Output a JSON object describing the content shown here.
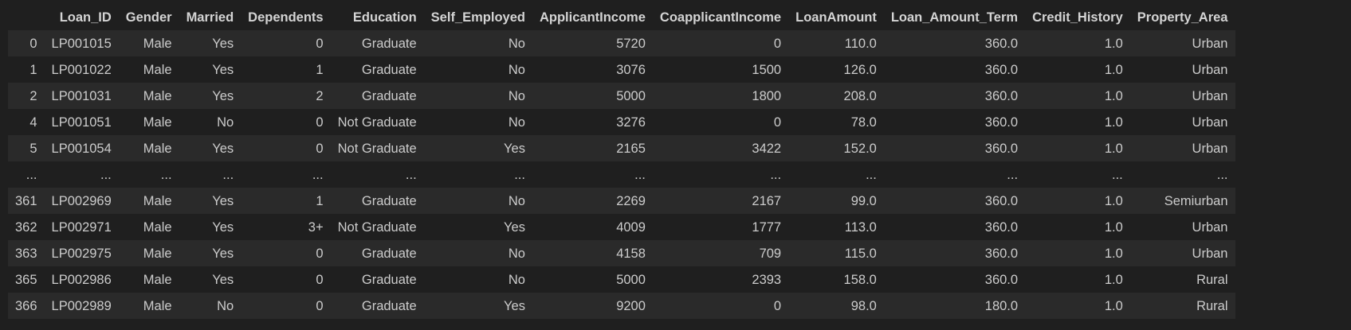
{
  "table": {
    "columns": [
      "",
      "Loan_ID",
      "Gender",
      "Married",
      "Dependents",
      "Education",
      "Self_Employed",
      "ApplicantIncome",
      "CoapplicantIncome",
      "LoanAmount",
      "Loan_Amount_Term",
      "Credit_History",
      "Property_Area"
    ],
    "rows": [
      [
        "0",
        "LP001015",
        "Male",
        "Yes",
        "0",
        "Graduate",
        "No",
        "5720",
        "0",
        "110.0",
        "360.0",
        "1.0",
        "Urban"
      ],
      [
        "1",
        "LP001022",
        "Male",
        "Yes",
        "1",
        "Graduate",
        "No",
        "3076",
        "1500",
        "126.0",
        "360.0",
        "1.0",
        "Urban"
      ],
      [
        "2",
        "LP001031",
        "Male",
        "Yes",
        "2",
        "Graduate",
        "No",
        "5000",
        "1800",
        "208.0",
        "360.0",
        "1.0",
        "Urban"
      ],
      [
        "4",
        "LP001051",
        "Male",
        "No",
        "0",
        "Not Graduate",
        "No",
        "3276",
        "0",
        "78.0",
        "360.0",
        "1.0",
        "Urban"
      ],
      [
        "5",
        "LP001054",
        "Male",
        "Yes",
        "0",
        "Not Graduate",
        "Yes",
        "2165",
        "3422",
        "152.0",
        "360.0",
        "1.0",
        "Urban"
      ],
      [
        "...",
        "...",
        "...",
        "...",
        "...",
        "...",
        "...",
        "...",
        "...",
        "...",
        "...",
        "...",
        "..."
      ],
      [
        "361",
        "LP002969",
        "Male",
        "Yes",
        "1",
        "Graduate",
        "No",
        "2269",
        "2167",
        "99.0",
        "360.0",
        "1.0",
        "Semiurban"
      ],
      [
        "362",
        "LP002971",
        "Male",
        "Yes",
        "3+",
        "Not Graduate",
        "Yes",
        "4009",
        "1777",
        "113.0",
        "360.0",
        "1.0",
        "Urban"
      ],
      [
        "363",
        "LP002975",
        "Male",
        "Yes",
        "0",
        "Graduate",
        "No",
        "4158",
        "709",
        "115.0",
        "360.0",
        "1.0",
        "Urban"
      ],
      [
        "365",
        "LP002986",
        "Male",
        "Yes",
        "0",
        "Graduate",
        "No",
        "5000",
        "2393",
        "158.0",
        "360.0",
        "1.0",
        "Rural"
      ],
      [
        "366",
        "LP002989",
        "Male",
        "No",
        "0",
        "Graduate",
        "Yes",
        "9200",
        "0",
        "98.0",
        "180.0",
        "1.0",
        "Rural"
      ]
    ]
  },
  "colors": {
    "background": "#1f1f1f",
    "row_stripe": "#2a2a2a",
    "text": "#cccccc"
  }
}
